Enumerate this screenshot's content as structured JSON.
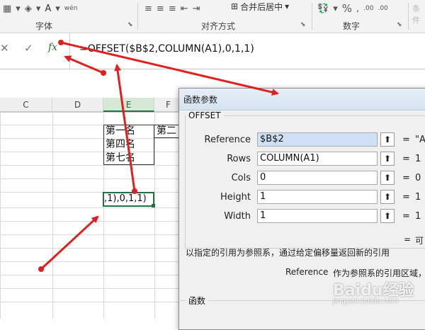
{
  "ribbon": {
    "group_font": "字体",
    "group_alignment": "对齐方式",
    "group_number": "数字",
    "merge_center_label": "合并后居中",
    "percent_symbol": "%",
    "comma_symbol": ",",
    "font_color_glyph": "A",
    "wen_glyph": "wén",
    "partial_right_label": "条件"
  },
  "formula_bar": {
    "cancel_glyph": "✕",
    "enter_glyph": "✓",
    "fx_label": "fx",
    "formula_before": "=OFFSET($B$2,COLUMN(A1)",
    "formula_red": ",",
    "formula_after": "0,1,1)"
  },
  "sheet": {
    "columns": [
      "C",
      "D",
      "E",
      "F"
    ],
    "cells": {
      "e1": "第一名",
      "f1": "第二",
      "e2": "第四名",
      "e3": "第七名",
      "edit": ",1),0,1,1)"
    }
  },
  "dialog": {
    "title": "函数参数",
    "function_name": "OFFSET",
    "args": [
      {
        "label": "Reference",
        "value": "$B$2",
        "result": "\"A"
      },
      {
        "label": "Rows",
        "value": "COLUMN(A1)",
        "result": "1"
      },
      {
        "label": "Cols",
        "value": "0",
        "result": "0"
      },
      {
        "label": "Height",
        "value": "1",
        "result": "1"
      },
      {
        "label": "Width",
        "value": "1",
        "result": "1"
      }
    ],
    "result_eq": "=",
    "result_partial": "可",
    "description": "以指定的引用为参照系，通过给定偏移量返回新的引用",
    "arg_help_name": "Reference",
    "arg_help_text": "作为参照系的引用区域，",
    "lower_section": "函数",
    "collapse_glyph": "⬆"
  },
  "watermark": {
    "text": "Baidu经验",
    "sub": "jingyan.baidu.com"
  },
  "colors": {
    "excel_green": "#217346",
    "arrow_red": "#e02020"
  }
}
